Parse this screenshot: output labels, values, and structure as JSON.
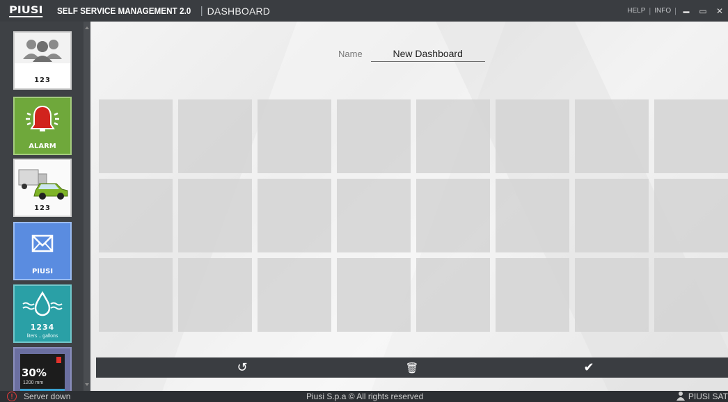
{
  "titlebar": {
    "logo": "PIUSI",
    "app_title": "SELF SERVICE MANAGEMENT 2.0",
    "separator": "|",
    "page_title": "DASHBOARD",
    "help": "HELP",
    "info": "INFO",
    "minimize": "▬",
    "maximize": "▭",
    "close": "✕"
  },
  "sidebar": {
    "tiles": [
      {
        "label": "123",
        "icon": "users-group-icon"
      },
      {
        "label": "ALARM",
        "icon": "alarm-bell-icon"
      },
      {
        "label": "123",
        "icon": "vehicles-icon"
      },
      {
        "label": "PIUSI",
        "icon": "envelope-icon"
      },
      {
        "label": "1234",
        "sublabel": "liters .. gallons",
        "icon": "fuel-drop-icon"
      },
      {
        "label": "30%",
        "sublabel": "1200 mm",
        "icon": "tank-level-icon"
      }
    ]
  },
  "main": {
    "name_label": "Name",
    "name_value": "New Dashboard",
    "grid": {
      "rows": 3,
      "cols": 8
    }
  },
  "actions": {
    "undo_icon": "↺",
    "delete_icon": "🗑",
    "confirm_icon": "✔"
  },
  "status": {
    "server": "Server down",
    "copyright": "Piusi S.p.a © All rights reserved",
    "user": "PIUSI SAT"
  }
}
